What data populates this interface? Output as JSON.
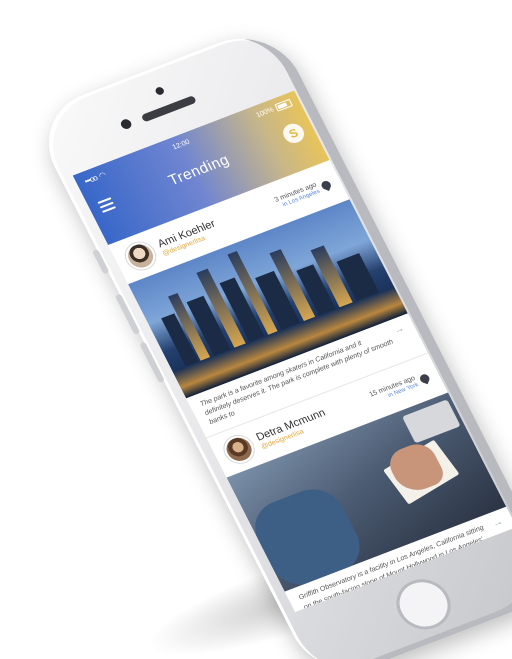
{
  "status_bar": {
    "signal": "•••oo",
    "wifi_icon": "wifi-icon",
    "time": "12:00",
    "battery": "100%"
  },
  "header": {
    "menu_icon": "hamburger-menu-icon",
    "title": "Trending",
    "profile_icon": "profile-badge-icon",
    "profile_glyph": "S"
  },
  "colors": {
    "header_gradient_start": "#3867c9",
    "header_gradient_end": "#e8c45a",
    "handle": "#e0a93b",
    "location": "#5b8ad6"
  },
  "feed": [
    {
      "author": "Ami Koehler",
      "handle": "@designerlisa",
      "time_ago": "3 minutes ago",
      "location": "in Los Angeles",
      "image": "city skyline at dusk",
      "caption": "The park is a favorite among skaters in California and it definitely deserves it. The park is complete with plenty of smooth banks to"
    },
    {
      "author": "Detra Mcmunn",
      "handle": "@designerlisa",
      "time_ago": "15 minutes ago",
      "location": "in New York",
      "image": "hand writing in notebook",
      "caption": "Griffith Observatory is a facility in Los Angeles, California sitting on the south-facing slope of Mount Hollywood in Los Angeles'"
    }
  ]
}
